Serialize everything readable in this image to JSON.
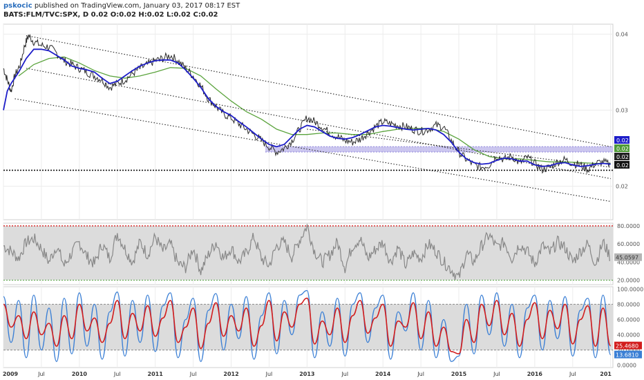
{
  "header": {
    "author": "pskocic",
    "published_text": "published on TradingView.com, January 03, 2017 08:17 EST",
    "symbol": "BATS:FLM/TVC:SPX, D",
    "ohlc": "0.02 O:0.02 H:0.02 L:0.02 C:0.02"
  },
  "colors": {
    "price": "#2b2b2b",
    "ma_fast": "#1c1cc8",
    "ma_slow": "#5aa33c",
    "rsi": "#888888",
    "stoch_k": "#3a7fd5",
    "stoch_d": "#d21c1c",
    "band": "#dcdcdc",
    "zone": "#b9b3ea"
  },
  "chart_data": [
    {
      "type": "line",
      "name": "price",
      "y_ticks": [
        "0.04",
        "0.03",
        "0.02"
      ],
      "ylim": [
        0.0156,
        0.0413
      ],
      "x_ticks": [
        "2009",
        "Jul",
        "2010",
        "Jul",
        "2011",
        "Jul",
        "2012",
        "Jul",
        "2013",
        "Jul",
        "2014",
        "Jul",
        "2015",
        "Jul",
        "2016",
        "Jul",
        "201"
      ],
      "series": [
        {
          "role": "close",
          "x": [
            2009.0,
            2009.05,
            2009.1,
            2009.15,
            2009.22,
            2009.28,
            2009.33,
            2009.4,
            2009.5,
            2009.6,
            2009.7,
            2009.8,
            2009.9,
            2010.0,
            2010.1,
            2010.2,
            2010.3,
            2010.4,
            2010.5,
            2010.6,
            2010.7,
            2010.8,
            2010.9,
            2011.0,
            2011.1,
            2011.2,
            2011.3,
            2011.4,
            2011.5,
            2011.6,
            2011.7,
            2011.8,
            2011.9,
            2012.0,
            2012.1,
            2012.2,
            2012.3,
            2012.4,
            2012.5,
            2012.6,
            2012.7,
            2012.8,
            2012.9,
            2013.0,
            2013.1,
            2013.2,
            2013.3,
            2013.4,
            2013.5,
            2013.6,
            2013.7,
            2013.8,
            2013.9,
            2014.0,
            2014.1,
            2014.2,
            2014.3,
            2014.4,
            2014.5,
            2014.6,
            2014.7,
            2014.8,
            2014.9,
            2015.0,
            2015.1,
            2015.2,
            2015.3,
            2015.4,
            2015.5,
            2015.6,
            2015.7,
            2015.8,
            2015.9,
            2016.0,
            2016.1,
            2016.2,
            2016.3,
            2016.4,
            2016.5,
            2016.6,
            2016.7,
            2016.8,
            2016.9,
            2017.0
          ],
          "values": [
            0.0355,
            0.034,
            0.0325,
            0.0345,
            0.036,
            0.0385,
            0.0398,
            0.039,
            0.0385,
            0.0383,
            0.0375,
            0.0365,
            0.036,
            0.0355,
            0.035,
            0.0345,
            0.034,
            0.033,
            0.0335,
            0.034,
            0.0348,
            0.0355,
            0.036,
            0.0365,
            0.0368,
            0.0372,
            0.0365,
            0.0355,
            0.0345,
            0.0332,
            0.0315,
            0.0305,
            0.0295,
            0.029,
            0.0282,
            0.0275,
            0.0268,
            0.026,
            0.0252,
            0.0245,
            0.025,
            0.026,
            0.0275,
            0.029,
            0.0285,
            0.0278,
            0.027,
            0.0265,
            0.026,
            0.0258,
            0.0262,
            0.027,
            0.0278,
            0.0285,
            0.0282,
            0.028,
            0.0278,
            0.0275,
            0.0272,
            0.0275,
            0.028,
            0.0278,
            0.026,
            0.0245,
            0.0235,
            0.0228,
            0.0225,
            0.0228,
            0.024,
            0.0235,
            0.024,
            0.023,
            0.0238,
            0.023,
            0.0222,
            0.0225,
            0.0232,
            0.0235,
            0.023,
            0.0228,
            0.0222,
            0.023,
            0.0232,
            0.0228
          ]
        },
        {
          "role": "moving average (blue)",
          "x": [
            2009.0,
            2009.05,
            2009.1,
            2009.2,
            2009.3,
            2009.4,
            2009.5,
            2009.6,
            2009.7,
            2009.8,
            2009.9,
            2010.0,
            2010.1,
            2010.2,
            2010.3,
            2010.4,
            2010.5,
            2010.6,
            2010.7,
            2010.8,
            2010.9,
            2011.0,
            2011.1,
            2011.2,
            2011.3,
            2011.4,
            2011.5,
            2011.6,
            2011.7,
            2011.8,
            2011.9,
            2012.0,
            2012.1,
            2012.2,
            2012.3,
            2012.4,
            2012.5,
            2012.6,
            2012.7,
            2012.8,
            2012.9,
            2013.0,
            2013.1,
            2013.2,
            2013.3,
            2013.4,
            2013.5,
            2013.6,
            2013.7,
            2013.8,
            2013.9,
            2014.0,
            2014.1,
            2014.2,
            2014.3,
            2014.4,
            2014.5,
            2014.6,
            2014.7,
            2014.8,
            2014.9,
            2015.0,
            2015.1,
            2015.2,
            2015.3,
            2015.4,
            2015.5,
            2015.6,
            2015.7,
            2015.8,
            2015.9,
            2016.0,
            2016.1,
            2016.2,
            2016.3,
            2016.4,
            2016.5,
            2016.6,
            2016.7,
            2016.8,
            2016.9,
            2017.0
          ],
          "values": [
            0.03,
            0.0325,
            0.0335,
            0.035,
            0.0368,
            0.038,
            0.038,
            0.0378,
            0.0372,
            0.0366,
            0.0358,
            0.0355,
            0.0353,
            0.035,
            0.0342,
            0.0335,
            0.0338,
            0.0345,
            0.0352,
            0.0358,
            0.0362,
            0.0365,
            0.0366,
            0.0366,
            0.0362,
            0.0353,
            0.0342,
            0.033,
            0.0315,
            0.0305,
            0.0298,
            0.0293,
            0.0285,
            0.0278,
            0.027,
            0.0262,
            0.0255,
            0.0252,
            0.0255,
            0.0265,
            0.0275,
            0.028,
            0.0278,
            0.0272,
            0.0266,
            0.0263,
            0.0262,
            0.0264,
            0.0268,
            0.0273,
            0.0278,
            0.028,
            0.0279,
            0.0277,
            0.0275,
            0.0274,
            0.0275,
            0.0276,
            0.0274,
            0.0268,
            0.0258,
            0.0245,
            0.0236,
            0.0231,
            0.0229,
            0.023,
            0.0234,
            0.0237,
            0.0236,
            0.0233,
            0.0233,
            0.0228,
            0.0226,
            0.0227,
            0.023,
            0.0231,
            0.0228,
            0.0226,
            0.0227,
            0.0229,
            0.023,
            0.0229
          ]
        },
        {
          "role": "moving average (green)",
          "x": [
            2009.2,
            2009.4,
            2009.6,
            2009.8,
            2010.0,
            2010.2,
            2010.4,
            2010.6,
            2010.8,
            2011.0,
            2011.2,
            2011.4,
            2011.6,
            2011.8,
            2012.0,
            2012.2,
            2012.4,
            2012.6,
            2012.8,
            2013.0,
            2013.2,
            2013.4,
            2013.6,
            2013.8,
            2014.0,
            2014.2,
            2014.4,
            2014.6,
            2014.8,
            2015.0,
            2015.2,
            2015.4,
            2015.6,
            2015.8,
            2016.0,
            2016.2,
            2016.4,
            2016.6,
            2016.8,
            2017.0
          ],
          "values": [
            0.0345,
            0.036,
            0.0368,
            0.037,
            0.0362,
            0.0352,
            0.0345,
            0.0342,
            0.0345,
            0.035,
            0.0356,
            0.0355,
            0.0345,
            0.0328,
            0.0312,
            0.0298,
            0.0288,
            0.0275,
            0.0268,
            0.0268,
            0.027,
            0.027,
            0.0268,
            0.0268,
            0.0272,
            0.0275,
            0.0276,
            0.0276,
            0.0272,
            0.0262,
            0.0248,
            0.0239,
            0.0236,
            0.0236,
            0.0234,
            0.0232,
            0.0232,
            0.0231,
            0.023,
            0.023
          ]
        }
      ],
      "price_tags": [
        "0.02",
        "0.02",
        "0.02",
        "0.02"
      ]
    },
    {
      "type": "line",
      "name": "rsi",
      "y_ticks": [
        "80.0000",
        "60.0000",
        "40.0000",
        "20.0000"
      ],
      "ylim": [
        15,
        83
      ],
      "levels": [
        80,
        20
      ],
      "band": [
        20,
        80
      ],
      "series": [
        {
          "role": "rsi",
          "x": [
            2009.0,
            2009.1,
            2009.2,
            2009.3,
            2009.4,
            2009.5,
            2009.6,
            2009.7,
            2009.8,
            2009.9,
            2010.0,
            2010.1,
            2010.2,
            2010.3,
            2010.4,
            2010.5,
            2010.6,
            2010.7,
            2010.8,
            2010.9,
            2011.0,
            2011.1,
            2011.2,
            2011.3,
            2011.4,
            2011.5,
            2011.6,
            2011.7,
            2011.8,
            2011.9,
            2012.0,
            2012.1,
            2012.2,
            2012.3,
            2012.4,
            2012.5,
            2012.6,
            2012.7,
            2012.8,
            2012.9,
            2013.0,
            2013.1,
            2013.2,
            2013.3,
            2013.4,
            2013.5,
            2013.6,
            2013.7,
            2013.8,
            2013.9,
            2014.0,
            2014.1,
            2014.2,
            2014.3,
            2014.4,
            2014.5,
            2014.6,
            2014.7,
            2014.8,
            2014.9,
            2015.0,
            2015.1,
            2015.2,
            2015.3,
            2015.4,
            2015.5,
            2015.6,
            2015.7,
            2015.8,
            2015.9,
            2016.0,
            2016.1,
            2016.2,
            2016.3,
            2016.4,
            2016.5,
            2016.6,
            2016.7,
            2016.8,
            2016.9,
            2017.0
          ],
          "values": [
            58,
            52,
            44,
            62,
            66,
            55,
            40,
            58,
            36,
            50,
            62,
            46,
            38,
            60,
            44,
            72,
            55,
            40,
            62,
            48,
            68,
            52,
            60,
            38,
            34,
            56,
            30,
            48,
            62,
            44,
            56,
            40,
            50,
            68,
            44,
            36,
            58,
            62,
            46,
            64,
            80,
            52,
            40,
            48,
            62,
            34,
            58,
            66,
            44,
            54,
            62,
            40,
            56,
            36,
            50,
            44,
            60,
            52,
            40,
            32,
            22,
            50,
            40,
            58,
            70,
            56,
            62,
            44,
            60,
            52,
            38,
            58,
            50,
            62,
            56,
            40,
            52,
            60,
            38,
            62,
            45
          ]
        }
      ],
      "last_value": "45.0597"
    },
    {
      "type": "line",
      "name": "stochastic",
      "y_ticks": [
        "100.0000",
        "80.0000",
        "60.0000",
        "40.0000",
        "20.0000",
        "0.0000"
      ],
      "ylim": [
        -3,
        103
      ],
      "levels": [
        80,
        20
      ],
      "band": [
        20,
        80
      ],
      "series": [
        {
          "role": "%K (blue)",
          "x": [
            2009.0,
            2009.1,
            2009.2,
            2009.3,
            2009.4,
            2009.5,
            2009.6,
            2009.7,
            2009.8,
            2009.9,
            2010.0,
            2010.1,
            2010.2,
            2010.3,
            2010.4,
            2010.5,
            2010.6,
            2010.7,
            2010.8,
            2010.9,
            2011.0,
            2011.1,
            2011.2,
            2011.3,
            2011.4,
            2011.5,
            2011.6,
            2011.7,
            2011.8,
            2011.9,
            2012.0,
            2012.1,
            2012.2,
            2012.3,
            2012.4,
            2012.5,
            2012.6,
            2012.7,
            2012.8,
            2012.9,
            2013.0,
            2013.1,
            2013.2,
            2013.3,
            2013.4,
            2013.5,
            2013.6,
            2013.7,
            2013.8,
            2013.9,
            2014.0,
            2014.1,
            2014.2,
            2014.3,
            2014.4,
            2014.5,
            2014.6,
            2014.7,
            2014.8,
            2014.9,
            2015.0,
            2015.1,
            2015.2,
            2015.3,
            2015.4,
            2015.5,
            2015.6,
            2015.7,
            2015.8,
            2015.9,
            2016.0,
            2016.1,
            2016.2,
            2016.3,
            2016.4,
            2016.5,
            2016.6,
            2016.7,
            2016.8,
            2016.9,
            2017.0
          ],
          "values": [
            90,
            30,
            85,
            10,
            92,
            20,
            75,
            5,
            88,
            15,
            95,
            25,
            80,
            8,
            70,
            96,
            12,
            85,
            30,
            92,
            18,
            78,
            95,
            10,
            60,
            88,
            5,
            72,
            94,
            20,
            80,
            35,
            90,
            8,
            65,
            95,
            15,
            85,
            40,
            92,
            98,
            10,
            70,
            25,
            88,
            12,
            80,
            95,
            30,
            75,
            92,
            8,
            70,
            45,
            95,
            20,
            85,
            10,
            60,
            5,
            12,
            80,
            15,
            92,
            40,
            95,
            25,
            80,
            10,
            75,
            92,
            20,
            85,
            35,
            90,
            12,
            72,
            88,
            10,
            92,
            13.681
          ]
        },
        {
          "role": "%D (red)",
          "x": [
            2009.0,
            2009.1,
            2009.2,
            2009.3,
            2009.4,
            2009.5,
            2009.6,
            2009.7,
            2009.8,
            2009.9,
            2010.0,
            2010.1,
            2010.2,
            2010.3,
            2010.4,
            2010.5,
            2010.6,
            2010.7,
            2010.8,
            2010.9,
            2011.0,
            2011.1,
            2011.2,
            2011.3,
            2011.4,
            2011.5,
            2011.6,
            2011.7,
            2011.8,
            2011.9,
            2012.0,
            2012.1,
            2012.2,
            2012.3,
            2012.4,
            2012.5,
            2012.6,
            2012.7,
            2012.8,
            2012.9,
            2013.0,
            2013.1,
            2013.2,
            2013.3,
            2013.4,
            2013.5,
            2013.6,
            2013.7,
            2013.8,
            2013.9,
            2014.0,
            2014.1,
            2014.2,
            2014.3,
            2014.4,
            2014.5,
            2014.6,
            2014.7,
            2014.8,
            2014.9,
            2015.0,
            2015.1,
            2015.2,
            2015.3,
            2015.4,
            2015.5,
            2015.6,
            2015.7,
            2015.8,
            2015.9,
            2016.0,
            2016.1,
            2016.2,
            2016.3,
            2016.4,
            2016.5,
            2016.6,
            2016.7,
            2016.8,
            2016.9,
            2017.0
          ],
          "values": [
            80,
            50,
            65,
            35,
            70,
            40,
            55,
            25,
            65,
            35,
            80,
            45,
            62,
            30,
            55,
            85,
            35,
            68,
            45,
            78,
            38,
            62,
            85,
            30,
            50,
            75,
            22,
            55,
            82,
            38,
            65,
            45,
            75,
            25,
            52,
            85,
            32,
            70,
            50,
            80,
            88,
            28,
            58,
            40,
            75,
            30,
            65,
            85,
            42,
            62,
            80,
            25,
            58,
            50,
            82,
            35,
            70,
            25,
            50,
            18,
            15,
            60,
            30,
            80,
            52,
            85,
            40,
            68,
            25,
            60,
            82,
            35,
            72,
            48,
            80,
            28,
            60,
            78,
            25,
            75,
            25.468
          ]
        }
      ],
      "last_values": [
        "25.4680",
        "13.6810"
      ]
    }
  ]
}
